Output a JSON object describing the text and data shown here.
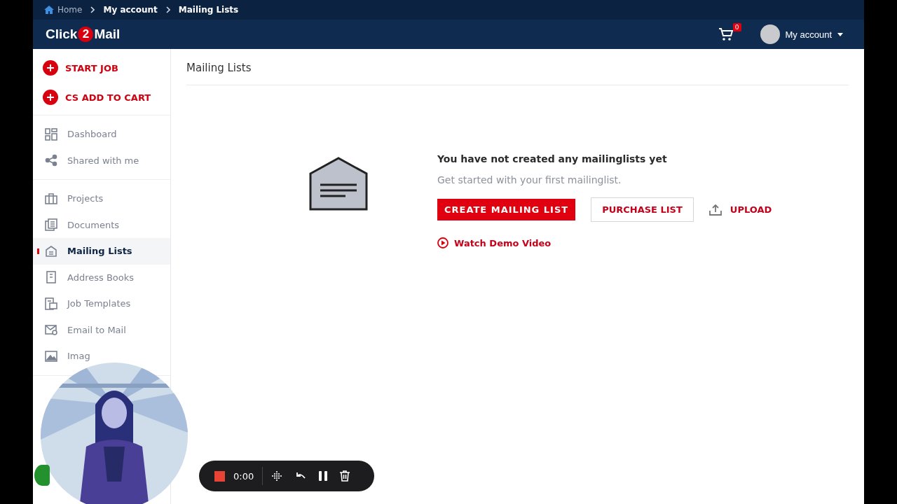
{
  "breadcrumb": [
    {
      "label": "Home",
      "kind": "home"
    },
    {
      "label": "My account",
      "kind": "link"
    },
    {
      "label": "Mailing Lists",
      "kind": "current"
    }
  ],
  "header": {
    "logo_left": "Click",
    "logo_digit": "2",
    "logo_right": "Mail",
    "cart_count": "0",
    "account": "My account"
  },
  "sidebar": {
    "actions": [
      {
        "label": "START JOB"
      },
      {
        "label": "CS ADD TO CART"
      }
    ],
    "groups": [
      [
        {
          "label": "Dashboard",
          "selected": false
        },
        {
          "label": "Shared with me",
          "selected": false
        }
      ],
      [
        {
          "label": "Projects",
          "selected": false
        },
        {
          "label": "Documents",
          "selected": false
        },
        {
          "label": "Mailing Lists",
          "selected": true
        },
        {
          "label": "Address Books",
          "selected": false
        },
        {
          "label": "Job Templates",
          "selected": false
        },
        {
          "label": "Email to Mail",
          "selected": false
        },
        {
          "label": "Imag",
          "selected": false
        }
      ]
    ]
  },
  "page": {
    "title": "Mailing Lists",
    "empty_title": "You have not created any mailinglists yet",
    "empty_text": "Get started with your first mailinglist.",
    "buttons": [
      {
        "label": "CREATE MAILING LIST",
        "kind": "primary"
      },
      {
        "label": "PURCHASE LIST",
        "kind": "outline"
      },
      {
        "label": "UPLOAD",
        "kind": "upload"
      }
    ],
    "demo_link": "Watch Demo Video"
  },
  "recorder": {
    "time": "0:00"
  }
}
